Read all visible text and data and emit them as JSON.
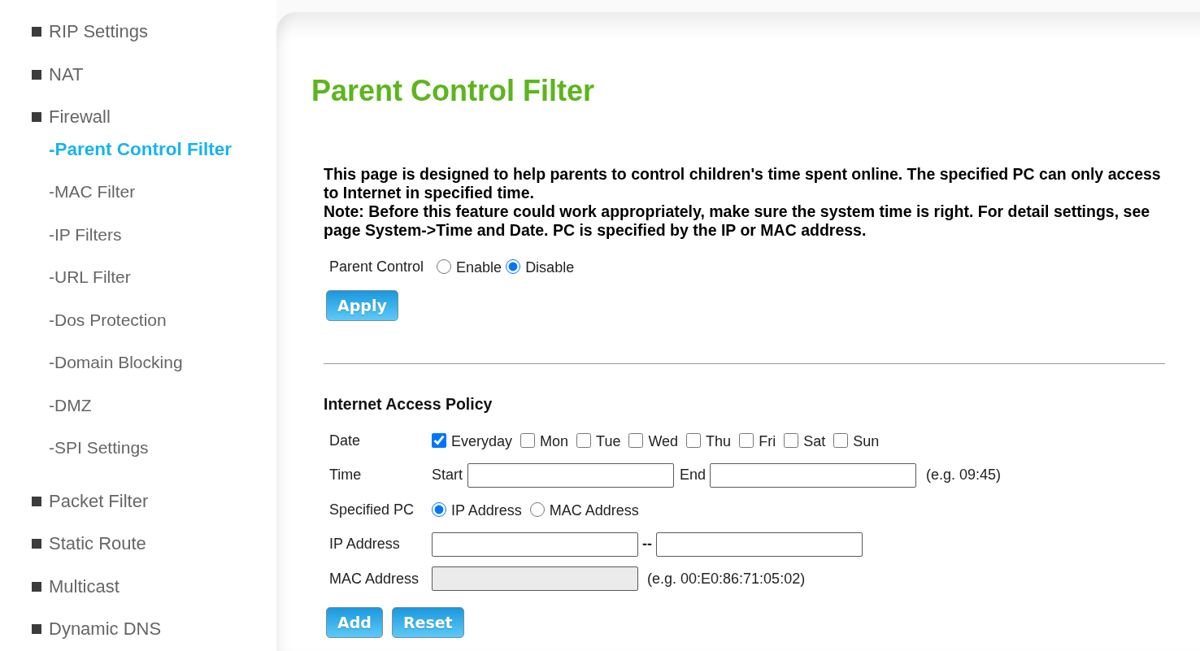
{
  "sidebar": {
    "items": [
      {
        "label": "RIP Settings",
        "selected": false
      },
      {
        "label": "NAT",
        "selected": false
      },
      {
        "label": "Firewall",
        "selected": false,
        "children": [
          {
            "label": "-Parent Control Filter",
            "selected": true
          },
          {
            "label": "-MAC Filter",
            "selected": false
          },
          {
            "label": "-IP Filters",
            "selected": false
          },
          {
            "label": "-URL Filter",
            "selected": false
          },
          {
            "label": "-Dos Protection",
            "selected": false
          },
          {
            "label": "-Domain Blocking",
            "selected": false
          },
          {
            "label": "-DMZ",
            "selected": false
          },
          {
            "label": "-SPI Settings",
            "selected": false
          }
        ]
      },
      {
        "label": "Packet Filter",
        "selected": false
      },
      {
        "label": "Static Route",
        "selected": false
      },
      {
        "label": "Multicast",
        "selected": false
      },
      {
        "label": "Dynamic DNS",
        "selected": false
      }
    ]
  },
  "page": {
    "title": "Parent Control Filter",
    "description": [
      "This page is designed to help parents to control children's time spent online. The specified PC can only access to Internet in specified time.",
      "Note: Before this feature could work appropriately, make sure the system time is right. For detail settings, see page System->Time and Date. PC is specified by the IP or MAC address."
    ]
  },
  "parent_control": {
    "label": "Parent Control",
    "options": [
      {
        "label": "Enable",
        "selected": false
      },
      {
        "label": "Disable",
        "selected": true
      }
    ],
    "button": "Apply"
  },
  "policy": {
    "heading": "Internet Access Policy",
    "rows": [
      {
        "kind": "checkboxes",
        "label": "Date",
        "options": [
          {
            "label": "Everyday",
            "checked": true
          },
          {
            "label": "Mon",
            "checked": false
          },
          {
            "label": "Tue",
            "checked": false
          },
          {
            "label": "Wed",
            "checked": false
          },
          {
            "label": "Thu",
            "checked": false
          },
          {
            "label": "Fri",
            "checked": false
          },
          {
            "label": "Sat",
            "checked": false
          },
          {
            "label": "Sun",
            "checked": false
          }
        ]
      },
      {
        "kind": "time",
        "label": "Time",
        "start_label": "Start",
        "end_label": "End",
        "hint": "(e.g. 09:45)"
      },
      {
        "kind": "radios",
        "label": "Specified PC",
        "options": [
          {
            "label": "IP Address",
            "selected": true
          },
          {
            "label": "MAC Address",
            "selected": false
          }
        ]
      },
      {
        "kind": "range",
        "label": "IP Address",
        "separator": "--"
      },
      {
        "kind": "field",
        "label": "MAC Address",
        "disabled": true,
        "hint": "(e.g. 00:E0:86:71:05:02)"
      }
    ]
  },
  "buttons": [
    "Add",
    "Reset"
  ]
}
